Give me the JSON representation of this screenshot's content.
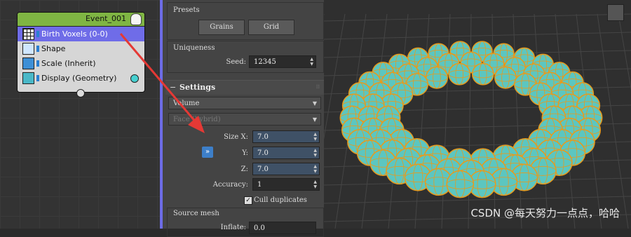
{
  "node": {
    "title": "Event_001",
    "operators": [
      {
        "label": "Birth Voxels (0-0)",
        "icon": "birth-voxels-icon",
        "selected": true
      },
      {
        "label": "Shape",
        "icon": "shape-icon",
        "selected": false
      },
      {
        "label": "Scale (Inherit)",
        "icon": "scale-icon",
        "selected": false
      },
      {
        "label": "Display (Geometry)",
        "icon": "display-icon",
        "selected": false
      }
    ]
  },
  "presets": {
    "title": "Presets",
    "buttons": [
      "Grains",
      "Grid"
    ]
  },
  "uniqueness": {
    "title": "Uniqueness",
    "seed_label": "Seed:",
    "seed_value": "12345"
  },
  "settings": {
    "title": "Settings",
    "mode": "Volume",
    "face_mode": "Face (hybrid)",
    "size_x_label": "Size X:",
    "size_x": "7.0",
    "y_label": "Y:",
    "y": "7.0",
    "z_label": "Z:",
    "z": "7.0",
    "link_button": "»",
    "accuracy_label": "Accuracy:",
    "accuracy": "1",
    "cull_label": "Cull duplicates",
    "cull_checked": true
  },
  "source_mesh": {
    "title": "Source mesh",
    "inflate_label": "Inflate:",
    "inflate": "0.0"
  },
  "watermark": "CSDN @每天努力一点点，哈哈",
  "colors": {
    "accent": "#6d6ce6",
    "node_title": "#7fb543",
    "sphere": "#5cc6c0",
    "wire": "#e89a1c",
    "arrow": "#e53935"
  }
}
